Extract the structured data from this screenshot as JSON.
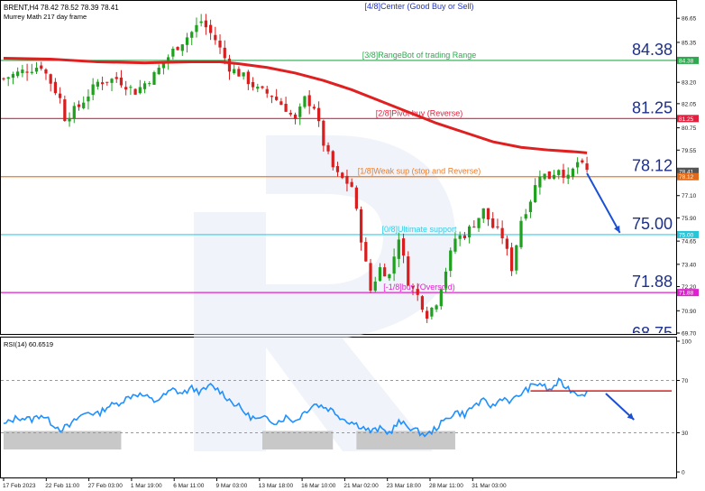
{
  "header": {
    "symbol_line": "BRENT,H4 78.42 78.52 78.39 78.41",
    "indicator_line": "Murrey Math 217 day frame"
  },
  "colors": {
    "bull": "#1fa01f",
    "bear": "#d81e1e",
    "ma": "#e02020",
    "rsi": "#1e90ff",
    "watermark": "#dbe3f0",
    "grid_text": "#202020"
  },
  "chart_data": [
    {
      "type": "candlestick",
      "title": "",
      "ylim": [
        69.7,
        87.0
      ],
      "y_ticks": [
        "86.65",
        "85.35",
        "84.38",
        "83.20",
        "82.05",
        "80.75",
        "79.55",
        "78.41",
        "78.12",
        "77.10",
        "75.90",
        "75.00",
        "74.65",
        "73.40",
        "72.20",
        "71.88",
        "70.90",
        "69.70"
      ],
      "price_tags": [
        {
          "label": "84.38",
          "color": "#2fa84f"
        },
        {
          "label": "81.25",
          "color": "#e21f3c"
        },
        {
          "label": "78.41",
          "color": "#555555"
        },
        {
          "label": "78.12",
          "color": "#e06a1a"
        },
        {
          "label": "75.00",
          "color": "#26c6da"
        },
        {
          "label": "71.88",
          "color": "#e11fd0"
        }
      ],
      "murrey_levels": [
        {
          "value": 87.5,
          "label": "[4/8]Center (Good Buy or Sell)",
          "big": "",
          "color": "#2233cc"
        },
        {
          "value": 84.38,
          "label": "[3/8]RangeBot of trading Range",
          "big": "84.38",
          "color": "#2fa84f"
        },
        {
          "value": 81.25,
          "label": "[2/8]Pivot buy (Reverse)",
          "big": "81.25",
          "color": "#e21f3c"
        },
        {
          "value": 78.12,
          "label": "[1/8]Weak sup (stop and Reverse)",
          "big": "78.12",
          "color": "#f07a20"
        },
        {
          "value": 75.0,
          "label": "[0/8]Ultimate support",
          "big": "75.00",
          "color": "#2fd0e8"
        },
        {
          "value": 71.88,
          "label": "[-1/8]buy (Oversold)",
          "big": "71.88",
          "color": "#e11fd0"
        }
      ],
      "x_labels": [
        "17 Feb 2023",
        "22 Feb 11:00",
        "27 Feb 03:00",
        "1 Mar 19:00",
        "6 Mar 11:00",
        "9 Mar 03:00",
        "13 Mar 18:00",
        "16 Mar 10:00",
        "21 Mar 02:00",
        "23 Mar 18:00",
        "28 Mar 11:00",
        "31 Mar 03:00"
      ],
      "close_path": [
        [
          0,
          83.4
        ],
        [
          4,
          83.8
        ],
        [
          8,
          84.1
        ],
        [
          12,
          82.3
        ],
        [
          13,
          81.3
        ],
        [
          16,
          81.9
        ],
        [
          20,
          83.2
        ],
        [
          24,
          83.4
        ],
        [
          28,
          82.7
        ],
        [
          32,
          83.6
        ],
        [
          36,
          84.9
        ],
        [
          40,
          85.9
        ],
        [
          42,
          86.5
        ],
        [
          45,
          85.5
        ],
        [
          48,
          84.0
        ],
        [
          51,
          83.5
        ],
        [
          54,
          82.8
        ],
        [
          57,
          82.5
        ],
        [
          60,
          81.8
        ],
        [
          62,
          81.1
        ],
        [
          64,
          82.3
        ],
        [
          66,
          81.9
        ],
        [
          68,
          79.9
        ],
        [
          70,
          78.6
        ],
        [
          71,
          78.2
        ],
        [
          74,
          77.6
        ],
        [
          76,
          74.8
        ],
        [
          78,
          72.0
        ],
        [
          80,
          73.2
        ],
        [
          82,
          72.8
        ],
        [
          84,
          74.9
        ],
        [
          86,
          72.5
        ],
        [
          88,
          71.7
        ],
        [
          90,
          70.7
        ],
        [
          92,
          71.4
        ],
        [
          94,
          73.1
        ],
        [
          96,
          74.8
        ],
        [
          98,
          75.0
        ],
        [
          100,
          75.6
        ],
        [
          102,
          76.3
        ],
        [
          104,
          75.4
        ],
        [
          106,
          74.9
        ],
        [
          108,
          73.2
        ],
        [
          110,
          75.8
        ],
        [
          112,
          76.9
        ],
        [
          114,
          78.3
        ],
        [
          116,
          78.1
        ],
        [
          118,
          78.6
        ],
        [
          120,
          78.0
        ],
        [
          122,
          78.9
        ],
        [
          124,
          78.4
        ]
      ],
      "moving_average": [
        [
          0,
          84.5
        ],
        [
          10,
          84.45
        ],
        [
          20,
          84.3
        ],
        [
          30,
          84.25
        ],
        [
          40,
          84.3
        ],
        [
          46,
          84.3
        ],
        [
          50,
          84.2
        ],
        [
          56,
          84.0
        ],
        [
          62,
          83.7
        ],
        [
          68,
          83.3
        ],
        [
          74,
          82.8
        ],
        [
          80,
          82.2
        ],
        [
          86,
          81.6
        ],
        [
          92,
          81.0
        ],
        [
          98,
          80.5
        ],
        [
          104,
          80.0
        ],
        [
          110,
          79.7
        ],
        [
          116,
          79.55
        ],
        [
          122,
          79.45
        ],
        [
          124,
          79.4
        ]
      ],
      "forecast_arrow": {
        "from": [
          124,
          78.3
        ],
        "to": [
          131,
          75.1
        ]
      }
    },
    {
      "type": "line",
      "title": "RSI(14) 60.6519",
      "ylim": [
        0,
        100
      ],
      "y_ticks": [
        "100",
        "70",
        "30",
        "0"
      ],
      "levels": [
        70,
        30
      ],
      "series": [
        {
          "values": [
            [
              0,
              36
            ],
            [
              3,
              42
            ],
            [
              6,
              40
            ],
            [
              8,
              44
            ],
            [
              10,
              38
            ],
            [
              12,
              33
            ],
            [
              14,
              35
            ],
            [
              16,
              42
            ],
            [
              18,
              46
            ],
            [
              20,
              44
            ],
            [
              22,
              50
            ],
            [
              24,
              52
            ],
            [
              26,
              56
            ],
            [
              28,
              60
            ],
            [
              30,
              58
            ],
            [
              32,
              54
            ],
            [
              34,
              58
            ],
            [
              36,
              63
            ],
            [
              38,
              60
            ],
            [
              40,
              64
            ],
            [
              42,
              61
            ],
            [
              44,
              66
            ],
            [
              46,
              62
            ],
            [
              48,
              55
            ],
            [
              50,
              50
            ],
            [
              52,
              43
            ],
            [
              54,
              40
            ],
            [
              56,
              41
            ],
            [
              58,
              38
            ],
            [
              60,
              42
            ],
            [
              62,
              39
            ],
            [
              64,
              46
            ],
            [
              66,
              52
            ],
            [
              68,
              50
            ],
            [
              70,
              47
            ],
            [
              72,
              41
            ],
            [
              74,
              38
            ],
            [
              76,
              35
            ],
            [
              78,
              31
            ],
            [
              80,
              33
            ],
            [
              82,
              30
            ],
            [
              84,
              38
            ],
            [
              86,
              35
            ],
            [
              88,
              31
            ],
            [
              90,
              28
            ],
            [
              92,
              34
            ],
            [
              94,
              40
            ],
            [
              96,
              46
            ],
            [
              98,
              44
            ],
            [
              100,
              51
            ],
            [
              102,
              54
            ],
            [
              104,
              50
            ],
            [
              106,
              57
            ],
            [
              108,
              54
            ],
            [
              110,
              60
            ],
            [
              112,
              65
            ],
            [
              114,
              68
            ],
            [
              116,
              62
            ],
            [
              118,
              69
            ],
            [
              120,
              64
            ],
            [
              122,
              60
            ],
            [
              124,
              60.6
            ]
          ]
        }
      ],
      "shaded_zones": [
        [
          0,
          25
        ],
        [
          55,
          70
        ],
        [
          75,
          96
        ]
      ],
      "resistance_line": {
        "from": [
          112,
          62
        ],
        "to": [
          142,
          62
        ]
      },
      "forecast_arrow": {
        "from": [
          128,
          60
        ],
        "to": [
          134,
          40
        ]
      }
    }
  ]
}
